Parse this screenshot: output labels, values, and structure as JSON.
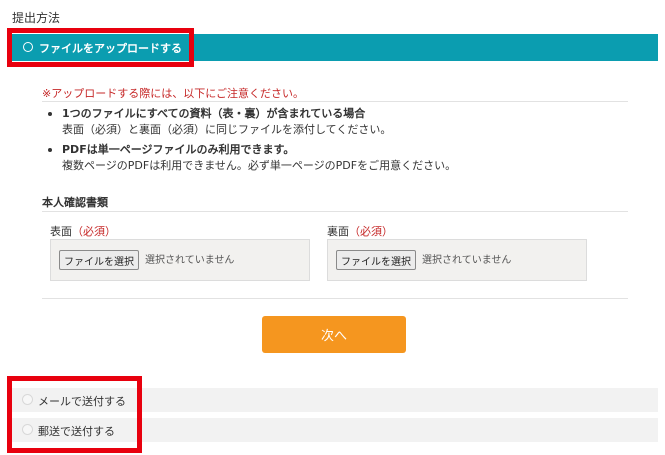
{
  "section_title": "提出方法",
  "upload_option": {
    "label": "ファイルをアップロードする",
    "selected": true
  },
  "notice": "※アップロードする際には、以下にご注意ください。",
  "notes": [
    {
      "title": "1つのファイルにすべての資料（表・裏）が含まれている場合",
      "detail": "表面（必須）と裏面（必須）に同じファイルを添付してください。"
    },
    {
      "title": "PDFは単一ページファイルのみ利用できます。",
      "detail": "複数ページのPDFは利用できません。必ず単一ページのPDFをご用意ください。"
    }
  ],
  "documents_heading": "本人確認書類",
  "fields": [
    {
      "label": "表面",
      "required": "（必須）",
      "button": "ファイルを選択",
      "status": "選択されていません"
    },
    {
      "label": "裏面",
      "required": "（必須）",
      "button": "ファイルを選択",
      "status": "選択されていません"
    }
  ],
  "next_button": "次へ",
  "other_options": [
    {
      "label": "メールで送付する",
      "selected": false
    },
    {
      "label": "郵送で送付する",
      "selected": false
    }
  ],
  "colors": {
    "accent": "#0b9db0",
    "next_button": "#f5961f",
    "highlight_box": "#e8000e",
    "notice_text": "#c62828"
  }
}
